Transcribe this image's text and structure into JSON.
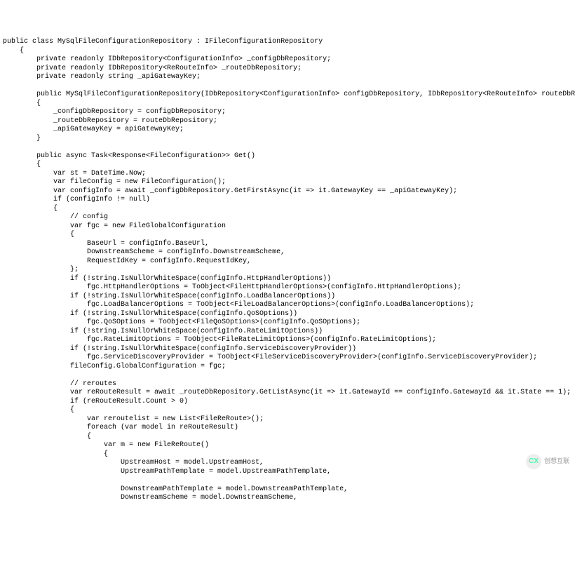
{
  "code": {
    "lines": [
      {
        "i": 0,
        "t": "public class MySqlFileConfigurationRepository : IFileConfigurationRepository"
      },
      {
        "i": 1,
        "t": "{"
      },
      {
        "i": 2,
        "t": "private readonly IDbRepository<ConfigurationInfo> _configDbRepository;"
      },
      {
        "i": 2,
        "t": "private readonly IDbRepository<ReRouteInfo> _routeDbRepository;"
      },
      {
        "i": 2,
        "t": "private readonly string _apiGatewayKey;"
      },
      {
        "i": 0,
        "t": ""
      },
      {
        "i": 2,
        "t": "public MySqlFileConfigurationRepository(IDbRepository<ConfigurationInfo> configDbRepository, IDbRepository<ReRouteInfo> routeDbR"
      },
      {
        "i": 2,
        "t": "{"
      },
      {
        "i": 3,
        "t": "_configDbRepository = configDbRepository;"
      },
      {
        "i": 3,
        "t": "_routeDbRepository = routeDbRepository;"
      },
      {
        "i": 3,
        "t": "_apiGatewayKey = apiGatewayKey;"
      },
      {
        "i": 2,
        "t": "}"
      },
      {
        "i": 0,
        "t": ""
      },
      {
        "i": 2,
        "t": "public async Task<Response<FileConfiguration>> Get()"
      },
      {
        "i": 2,
        "t": "{"
      },
      {
        "i": 3,
        "t": "var st = DateTime.Now;"
      },
      {
        "i": 3,
        "t": "var fileConfig = new FileConfiguration();"
      },
      {
        "i": 3,
        "t": "var configInfo = await _configDbRepository.GetFirstAsync(it => it.GatewayKey == _apiGatewayKey);"
      },
      {
        "i": 3,
        "t": "if (configInfo != null)"
      },
      {
        "i": 3,
        "t": "{"
      },
      {
        "i": 4,
        "t": "// config"
      },
      {
        "i": 4,
        "t": "var fgc = new FileGlobalConfiguration"
      },
      {
        "i": 4,
        "t": "{"
      },
      {
        "i": 5,
        "t": "BaseUrl = configInfo.BaseUrl,"
      },
      {
        "i": 5,
        "t": "DownstreamScheme = configInfo.DownstreamScheme,"
      },
      {
        "i": 5,
        "t": "RequestIdKey = configInfo.RequestIdKey,"
      },
      {
        "i": 4,
        "t": "};"
      },
      {
        "i": 4,
        "t": "if (!string.IsNullOrWhiteSpace(configInfo.HttpHandlerOptions))"
      },
      {
        "i": 5,
        "t": "fgc.HttpHandlerOptions = ToObject<FileHttpHandlerOptions>(configInfo.HttpHandlerOptions);"
      },
      {
        "i": 4,
        "t": "if (!string.IsNullOrWhiteSpace(configInfo.LoadBalancerOptions))"
      },
      {
        "i": 5,
        "t": "fgc.LoadBalancerOptions = ToObject<FileLoadBalancerOptions>(configInfo.LoadBalancerOptions);"
      },
      {
        "i": 4,
        "t": "if (!string.IsNullOrWhiteSpace(configInfo.QoSOptions))"
      },
      {
        "i": 5,
        "t": "fgc.QoSOptions = ToObject<FileQoSOptions>(configInfo.QoSOptions);"
      },
      {
        "i": 4,
        "t": "if (!string.IsNullOrWhiteSpace(configInfo.RateLimitOptions))"
      },
      {
        "i": 5,
        "t": "fgc.RateLimitOptions = ToObject<FileRateLimitOptions>(configInfo.RateLimitOptions);"
      },
      {
        "i": 4,
        "t": "if (!string.IsNullOrWhiteSpace(configInfo.ServiceDiscoveryProvider))"
      },
      {
        "i": 5,
        "t": "fgc.ServiceDiscoveryProvider = ToObject<FileServiceDiscoveryProvider>(configInfo.ServiceDiscoveryProvider);"
      },
      {
        "i": 4,
        "t": "fileConfig.GlobalConfiguration = fgc;"
      },
      {
        "i": 0,
        "t": ""
      },
      {
        "i": 4,
        "t": "// reroutes"
      },
      {
        "i": 4,
        "t": "var reRouteResult = await _routeDbRepository.GetListAsync(it => it.GatewayId == configInfo.GatewayId && it.State == 1);"
      },
      {
        "i": 4,
        "t": "if (reRouteResult.Count > 0)"
      },
      {
        "i": 4,
        "t": "{"
      },
      {
        "i": 5,
        "t": "var reroutelist = new List<FileReRoute>();"
      },
      {
        "i": 5,
        "t": "foreach (var model in reRouteResult)"
      },
      {
        "i": 5,
        "t": "{"
      },
      {
        "i": 6,
        "t": "var m = new FileReRoute()"
      },
      {
        "i": 6,
        "t": "{"
      },
      {
        "i": 7,
        "t": "UpstreamHost = model.UpstreamHost,"
      },
      {
        "i": 7,
        "t": "UpstreamPathTemplate = model.UpstreamPathTemplate,"
      },
      {
        "i": 0,
        "t": ""
      },
      {
        "i": 7,
        "t": "DownstreamPathTemplate = model.DownstreamPathTemplate,"
      },
      {
        "i": 7,
        "t": "DownstreamScheme = model.DownstreamScheme,"
      }
    ]
  },
  "watermark": {
    "icon": "CX",
    "text": "创想互联"
  }
}
